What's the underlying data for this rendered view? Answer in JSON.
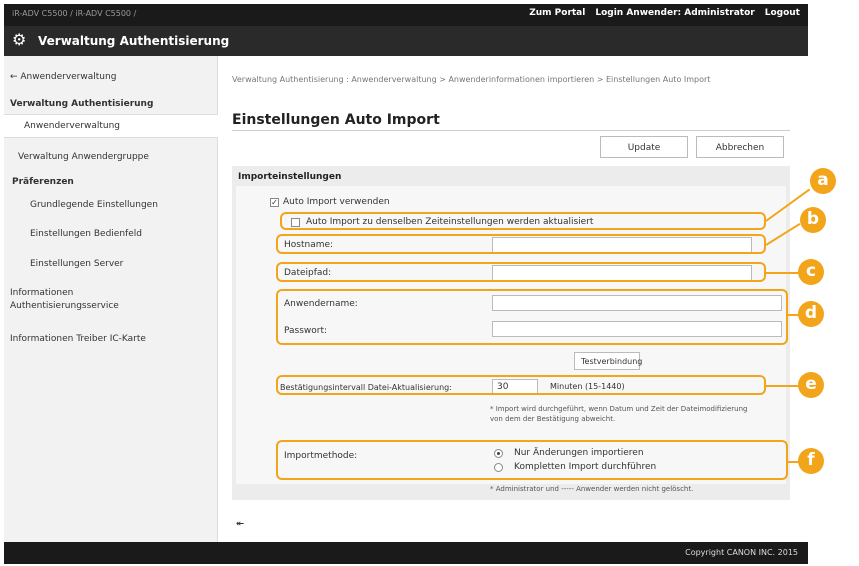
{
  "topbar": {
    "models": "iR-ADV C5500 / iR-ADV C5500 /",
    "portal": "Zum Portal",
    "login_label": "Login Anwender:",
    "user": "Administrator",
    "logout": "Logout"
  },
  "app": {
    "title": "Verwaltung Authentisierung"
  },
  "sidebar": {
    "items": [
      {
        "label": "← Anwenderverwaltung"
      },
      {
        "label": "Verwaltung Authentisierung"
      },
      {
        "label": "Anwenderverwaltung"
      },
      {
        "label": "Verwaltung Anwendergruppe"
      },
      {
        "label": "Präferenzen"
      },
      {
        "label": "Grundlegende Einstellungen"
      },
      {
        "label": "Einstellungen Bedienfeld"
      },
      {
        "label": "Einstellungen Server"
      },
      {
        "label": "Informationen Authentisierungsservice"
      },
      {
        "label": "Informationen Treiber IC-Karte"
      }
    ]
  },
  "main": {
    "breadcrumb": "Verwaltung Authentisierung : Anwenderverwaltung > Anwenderinformationen importieren > Einstellungen Auto Import",
    "title": "Einstellungen Auto Import",
    "update_label": "Update",
    "cancel_label": "Abbrechen"
  },
  "form": {
    "section_title": "Importeinstellungen",
    "use_auto_import": {
      "label": "Auto Import verwenden",
      "checked": true
    },
    "update_same_time": {
      "label": "Auto Import zu denselben Zeiteinstellungen werden aktualisiert",
      "checked": false
    },
    "hostname": {
      "label": "Hostname:",
      "value": ""
    },
    "filepath": {
      "label": "Dateipfad:",
      "value": ""
    },
    "username": {
      "label": "Anwendername:",
      "value": ""
    },
    "password": {
      "label": "Passwort:",
      "value": ""
    },
    "test_button": "Testverbindung",
    "interval": {
      "label": "Bestätigungsintervall Datei-Aktualisierung:",
      "value": "30",
      "unit": "Minuten (15-1440)"
    },
    "interval_note": "* Import wird durchgeführt, wenn Datum und Zeit der Dateimodifizierung von dem der Bestätigung abweicht.",
    "method": {
      "label": "Importmethode:",
      "options": [
        "Nur Änderungen importieren",
        "Kompletten Import durchführen"
      ],
      "selected": 0
    },
    "method_note": "* Administrator und ----- Anwender werden nicht gelöscht."
  },
  "callouts": [
    "a",
    "b",
    "c",
    "d",
    "e",
    "f"
  ],
  "back_to_top": "⯬",
  "footer": {
    "copyright": "Copyright CANON INC. 2015"
  },
  "colors": {
    "accent": "#f2a51a",
    "header": "#1a1a1a"
  }
}
